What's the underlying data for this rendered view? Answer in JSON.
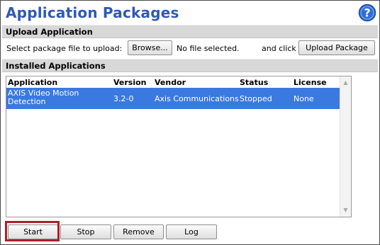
{
  "header": {
    "title": "Application Packages",
    "help_icon": "help-icon"
  },
  "upload": {
    "section_title": "Upload Application",
    "prompt": "Select package file to upload:",
    "browse_label": "Browse...",
    "file_status": "No file selected.",
    "and_click": "and click",
    "upload_label": "Upload Package"
  },
  "installed": {
    "section_title": "Installed Applications",
    "columns": [
      "Application",
      "Version",
      "Vendor",
      "Status",
      "License"
    ],
    "rows": [
      {
        "application": "AXIS Video Motion Detection",
        "version": "3.2-0",
        "vendor": "Axis Communications",
        "status": "Stopped",
        "license": "None",
        "selected": true
      }
    ]
  },
  "actions": {
    "start_label": "Start",
    "stop_label": "Stop",
    "remove_label": "Remove",
    "log_label": "Log"
  },
  "colors": {
    "title": "#2f58b6",
    "selection": "#3a79e0",
    "highlight": "#b01e2c",
    "section_bg": "#d8d8d8"
  }
}
